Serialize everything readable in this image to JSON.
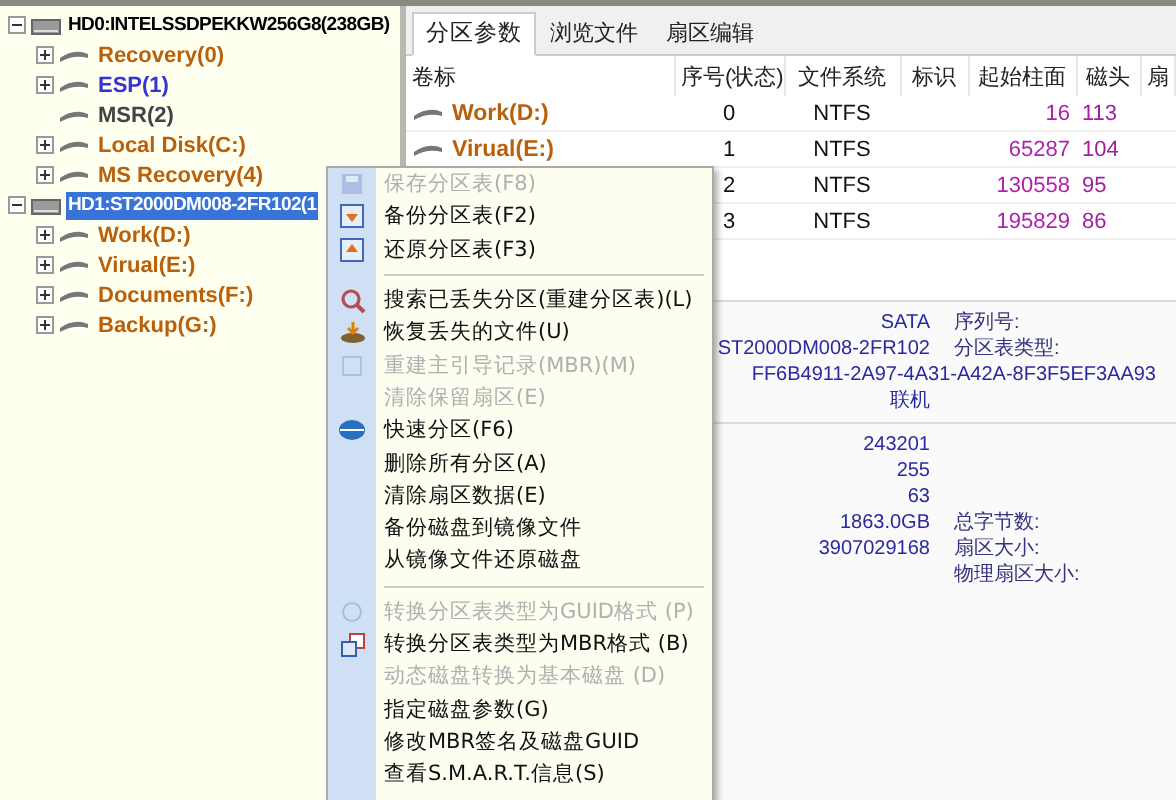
{
  "tree": [
    {
      "label": "HD0:INTELSSDPEKKW256G8(238GB)",
      "kind": "disk",
      "expanded": true,
      "selected": false,
      "children": [
        {
          "label": "Recovery(0)",
          "kind": "partition",
          "expanded": false,
          "selected": false,
          "color": "#b8600c"
        },
        {
          "label": "ESP(1)",
          "kind": "partition",
          "expanded": false,
          "selected": false,
          "color": "#3434d4"
        },
        {
          "label": "MSR(2)",
          "kind": "partition",
          "selected": false,
          "color": "#444444"
        },
        {
          "label": "Local Disk(C:)",
          "kind": "partition",
          "expanded": false,
          "selected": false,
          "color": "#b8600c"
        },
        {
          "label": "MS Recovery(4)",
          "kind": "partition",
          "expanded": false,
          "selected": false,
          "color": "#b8600c"
        }
      ]
    },
    {
      "label": "HD1:ST2000DM008-2FR102(1",
      "kind": "disk",
      "expanded": true,
      "selected": true,
      "children": [
        {
          "label": "Work(D:)",
          "kind": "partition",
          "expanded": false,
          "selected": false,
          "color": "#b8600c"
        },
        {
          "label": "Virual(E:)",
          "kind": "partition",
          "expanded": false,
          "selected": false,
          "color": "#b8600c"
        },
        {
          "label": "Documents(F:)",
          "kind": "partition",
          "expanded": false,
          "selected": false,
          "color": "#b8600c"
        },
        {
          "label": "Backup(G:)",
          "kind": "partition",
          "expanded": false,
          "selected": false,
          "color": "#b8600c"
        }
      ]
    }
  ],
  "tabs": [
    {
      "label": "分区参数",
      "selected": true
    },
    {
      "label": "浏览文件",
      "selected": false
    },
    {
      "label": "扇区编辑",
      "selected": false
    }
  ],
  "table": {
    "columns": [
      "卷标",
      "序号(状态)",
      "文件系统",
      "标识",
      "起始柱面",
      "磁头",
      "扇"
    ],
    "rows": [
      {
        "cells": [
          "Work(D:)",
          "0",
          "NTFS",
          "",
          "16",
          "113",
          ""
        ]
      },
      {
        "cells": [
          "Virual(E:)",
          "1",
          "NTFS",
          "",
          "65287",
          "104",
          ""
        ]
      },
      {
        "cells": [
          "",
          "2",
          "NTFS",
          "",
          "130558",
          "95",
          ""
        ]
      },
      {
        "cells": [
          "",
          "3",
          "NTFS",
          "",
          "195829",
          "86",
          ""
        ]
      }
    ]
  },
  "info": {
    "upper": [
      {
        "kind": "pair",
        "value": "SATA",
        "label": "序列号:"
      },
      {
        "kind": "pair",
        "value": "ST2000DM008-2FR102",
        "label": "分区表类型:"
      },
      {
        "kind": "wide",
        "value": "FF6B4911-2A97-4A31-A42A-8F3F5EF3AA93"
      },
      {
        "kind": "pair",
        "value": "联机"
      }
    ],
    "lower": [
      {
        "kind": "pair",
        "value": "243201"
      },
      {
        "kind": "pair",
        "value": "255"
      },
      {
        "kind": "pair",
        "value": "63"
      },
      {
        "kind": "pair",
        "value": "1863.0GB",
        "label": "总字节数:"
      },
      {
        "kind": "pair",
        "value": "3907029168",
        "label": "扇区大小:"
      },
      {
        "kind": "pair",
        "label": "物理扇区大小:"
      }
    ]
  },
  "context_menu": [
    {
      "kind": "item",
      "label": "保存分区表(F8)",
      "disabled": true
    },
    {
      "kind": "item",
      "label": "备份分区表(F2)",
      "disabled": false
    },
    {
      "kind": "item",
      "label": "还原分区表(F3)",
      "disabled": false
    },
    {
      "kind": "separator"
    },
    {
      "kind": "item",
      "label": "搜索已丢失分区(重建分区表)(L)",
      "disabled": false
    },
    {
      "kind": "item",
      "label": "恢复丢失的文件(U)",
      "disabled": false
    },
    {
      "kind": "item",
      "label": "重建主引导记录(MBR)(M)",
      "disabled": true
    },
    {
      "kind": "item",
      "label": "清除保留扇区(E)",
      "disabled": true
    },
    {
      "kind": "item",
      "label": "快速分区(F6)",
      "disabled": false
    },
    {
      "kind": "item",
      "label": "删除所有分区(A)",
      "disabled": false
    },
    {
      "kind": "item",
      "label": "清除扇区数据(E)",
      "disabled": false
    },
    {
      "kind": "item",
      "label": "备份磁盘到镜像文件",
      "disabled": false
    },
    {
      "kind": "item",
      "label": "从镜像文件还原磁盘",
      "disabled": false
    },
    {
      "kind": "separator"
    },
    {
      "kind": "item",
      "label": "转换分区表类型为GUID格式 (P)",
      "disabled": true
    },
    {
      "kind": "item",
      "label": "转换分区表类型为MBR格式 (B)",
      "disabled": false
    },
    {
      "kind": "item",
      "label": "动态磁盘转换为基本磁盘 (D)",
      "disabled": true
    },
    {
      "kind": "item",
      "label": "指定磁盘参数(G)",
      "disabled": false
    },
    {
      "kind": "item",
      "label": "修改MBR签名及磁盘GUID",
      "disabled": false
    },
    {
      "kind": "item",
      "label": "查看S.M.A.R.T.信息(S)",
      "disabled": false
    }
  ]
}
